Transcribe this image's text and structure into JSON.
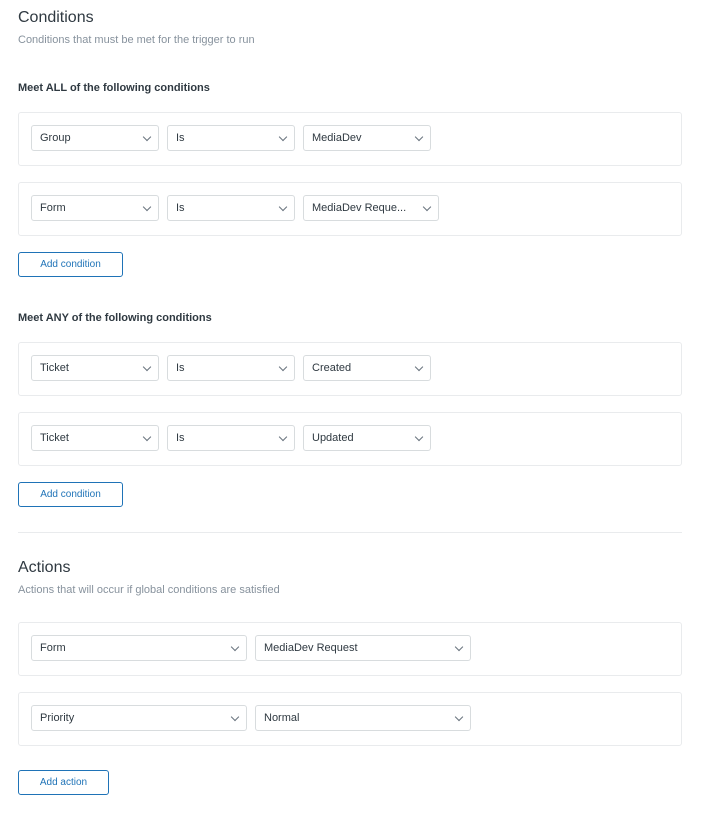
{
  "conditions": {
    "title": "Conditions",
    "description": "Conditions that must be met for the trigger to run",
    "all_group": {
      "label": "Meet ALL of the following conditions",
      "rows": [
        {
          "field": "Group",
          "operator": "Is",
          "value": "MediaDev"
        },
        {
          "field": "Form",
          "operator": "Is",
          "value": "MediaDev Reque..."
        }
      ],
      "add_label": "Add condition"
    },
    "any_group": {
      "label": "Meet ANY of the following conditions",
      "rows": [
        {
          "field": "Ticket",
          "operator": "Is",
          "value": "Created"
        },
        {
          "field": "Ticket",
          "operator": "Is",
          "value": "Updated"
        }
      ],
      "add_label": "Add condition"
    }
  },
  "actions": {
    "title": "Actions",
    "description": "Actions that will occur if global conditions are satisfied",
    "rows": [
      {
        "field": "Form",
        "value": "MediaDev Request"
      },
      {
        "field": "Priority",
        "value": "Normal"
      }
    ],
    "add_label": "Add action"
  }
}
